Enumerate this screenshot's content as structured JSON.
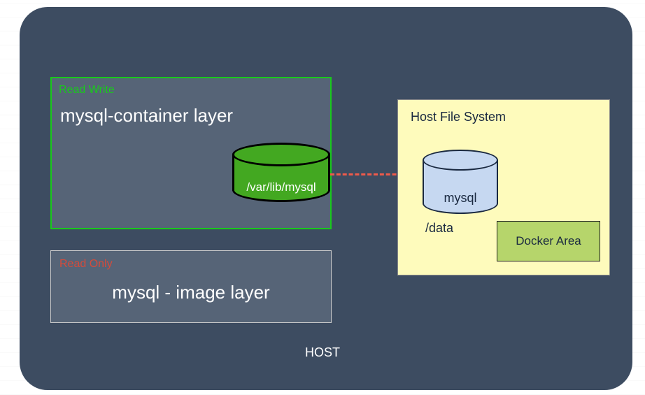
{
  "host": {
    "label": "HOST"
  },
  "rw_layer": {
    "title": "Read Write",
    "main": "mysql-container layer",
    "cylinder_label": "/var/lib/mysql"
  },
  "ro_layer": {
    "title": "Read Only",
    "main": "mysql - image layer"
  },
  "hfs": {
    "title": "Host File System",
    "cylinder_label": "mysql",
    "data_label": "/data",
    "docker_area_label": "Docker Area"
  }
}
